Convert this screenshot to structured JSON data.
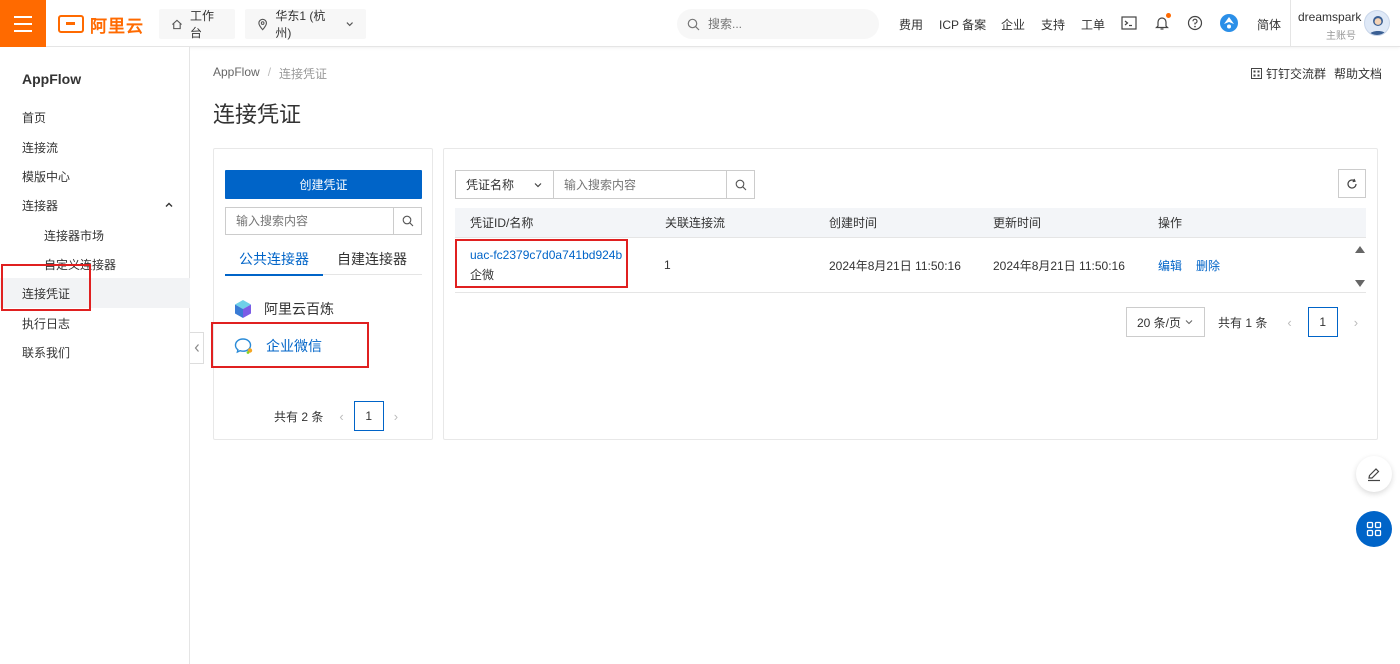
{
  "header": {
    "logo_text": "阿里云",
    "workbench_label": "工作台",
    "region_label": "华东1 (杭州)",
    "search_placeholder": "搜索...",
    "nav": [
      "费用",
      "ICP 备案",
      "企业",
      "支持",
      "工单"
    ],
    "lang_label": "简体",
    "user_name": "dreamspark",
    "user_role": "主账号",
    "icons": [
      "menu-icon",
      "home-icon",
      "location-pin-icon",
      "chevron-down-icon",
      "search-icon",
      "terminal-icon",
      "bell-icon",
      "help-icon",
      "assistant-icon"
    ]
  },
  "sidebar": {
    "title": "AppFlow",
    "items": [
      {
        "label": "首页"
      },
      {
        "label": "连接流"
      },
      {
        "label": "模版中心"
      },
      {
        "label": "连接器"
      },
      {
        "label": "连接器市场"
      },
      {
        "label": "自定义连接器"
      },
      {
        "label": "连接凭证"
      },
      {
        "label": "执行日志"
      },
      {
        "label": "联系我们"
      }
    ],
    "active_item": "连接凭证"
  },
  "breadcrumb": {
    "root": "AppFlow",
    "current": "连接凭证"
  },
  "page_title": "连接凭证",
  "top_links": {
    "dingtalk": "钉钉交流群",
    "help": "帮助文档"
  },
  "left_panel": {
    "create_button": "创建凭证",
    "search_placeholder": "输入搜索内容",
    "tabs": [
      "公共连接器",
      "自建连接器"
    ],
    "active_tab": "公共连接器",
    "connectors": [
      {
        "label": "阿里云百炼",
        "icon": "bailian-cube-icon"
      },
      {
        "label": "企业微信",
        "icon": "wecom-chat-icon"
      }
    ],
    "selected_connector": "企业微信",
    "pager": {
      "total": "共有 2 条",
      "page": "1"
    }
  },
  "right_panel": {
    "filter_field": "凭证名称",
    "search_placeholder": "输入搜索内容",
    "columns": [
      "凭证ID/名称",
      "关联连接流",
      "创建时间",
      "更新时间",
      "操作"
    ],
    "rows": [
      {
        "id": "uac-fc2379c7d0a741bd924b",
        "name": "企微",
        "flows": "1",
        "created": "2024年8月21日 11:50:16",
        "updated": "2024年8月21日 11:50:16",
        "actions": [
          "编辑",
          "删除"
        ]
      }
    ],
    "page_size": "20 条/页",
    "pager": {
      "total": "共有 1 条",
      "page": "1"
    }
  },
  "colors": {
    "brand_orange": "#ff6a00",
    "primary_blue": "#0064c8",
    "highlight_red": "#e02020"
  }
}
